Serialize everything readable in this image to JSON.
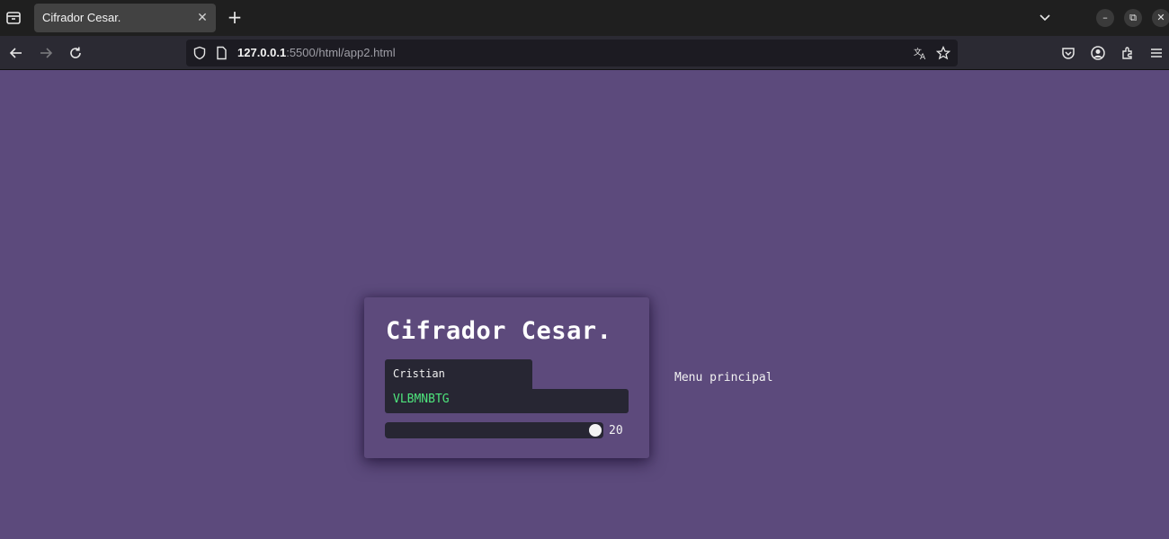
{
  "browser": {
    "tab": {
      "title": "Cifrador Cesar.",
      "close_glyph": "✕"
    },
    "new_tab_glyph": "+",
    "url": {
      "host": "127.0.0.1",
      "rest": ":5500/html/app2.html"
    },
    "window_controls": {
      "minimize": "–",
      "restore": "⧉",
      "close": "✕"
    },
    "icons": [
      "tab-list-icon",
      "back-icon",
      "forward-icon",
      "reload-icon",
      "shield-icon",
      "page-icon",
      "translate-icon",
      "star-icon",
      "pocket-icon",
      "account-icon",
      "extensions-icon",
      "menu-icon",
      "chevron-down-icon"
    ]
  },
  "app": {
    "title": "Cifrador Cesar.",
    "input_value": "Cristian",
    "output_value": "VLBMNBTG",
    "shift": {
      "value": "20",
      "min": 0,
      "max": 20
    },
    "menu_link": "Menu principal"
  },
  "colors": {
    "page_bg": "#5c4a7c",
    "field_bg": "#272633",
    "output_text": "#4ee47c"
  }
}
